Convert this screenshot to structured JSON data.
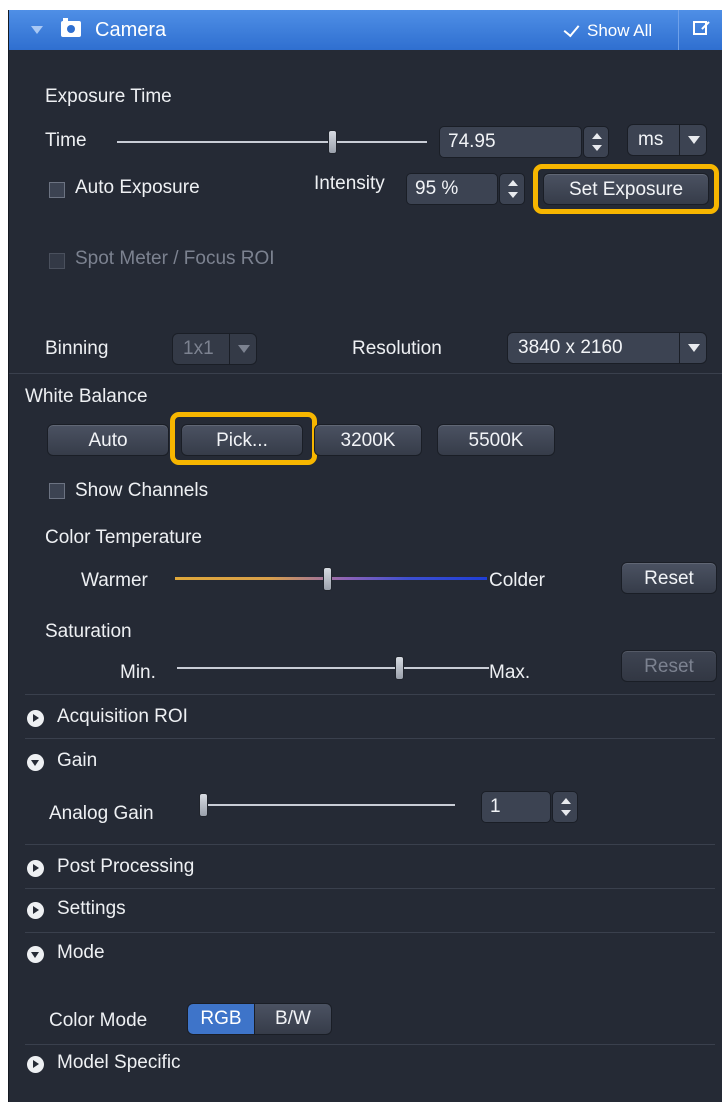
{
  "titlebar": {
    "title": "Camera",
    "show_all": "Show All",
    "icons": [
      "collapse-arrow-icon",
      "camera-icon",
      "checkmark-icon",
      "undock-icon"
    ]
  },
  "exposure": {
    "heading": "Exposure Time",
    "time_label": "Time",
    "time_value": "74.95",
    "time_slider_position": 0.7,
    "unit": "ms",
    "auto_exposure_label": "Auto Exposure",
    "intensity_label": "Intensity",
    "intensity_value": "95 %",
    "set_exposure_label": "Set Exposure",
    "spot_meter_label": "Spot Meter / Focus ROI"
  },
  "binning": {
    "label": "Binning",
    "value": "1x1",
    "resolution_label": "Resolution",
    "resolution_value": "3840 x 2160"
  },
  "white_balance": {
    "heading": "White Balance",
    "auto_label": "Auto",
    "pick_label": "Pick...",
    "k3200_label": "3200K",
    "k5500_label": "5500K",
    "show_channels_label": "Show Channels",
    "color_temp_heading": "Color Temperature",
    "warmer_label": "Warmer",
    "colder_label": "Colder",
    "color_temp_position": 0.49,
    "reset_label": "Reset",
    "saturation_heading": "Saturation",
    "min_label": "Min.",
    "max_label": "Max.",
    "saturation_position": 0.72,
    "saturation_reset_label": "Reset"
  },
  "sections": {
    "acquisition_roi": "Acquisition ROI",
    "gain": "Gain",
    "analog_gain_label": "Analog Gain",
    "analog_gain_value": "1",
    "analog_gain_position": 0.0,
    "post_processing": "Post Processing",
    "settings": "Settings",
    "mode": "Mode",
    "color_mode_label": "Color Mode",
    "color_mode_options": [
      "RGB",
      "B/W"
    ],
    "color_mode_selected": "RGB",
    "model_specific": "Model Specific"
  },
  "colors": {
    "panel_bg": "#252a35",
    "titlebar_blue": "#3a7ddb",
    "highlight": "#f7b600",
    "selected_segment": "#3e74c9"
  }
}
